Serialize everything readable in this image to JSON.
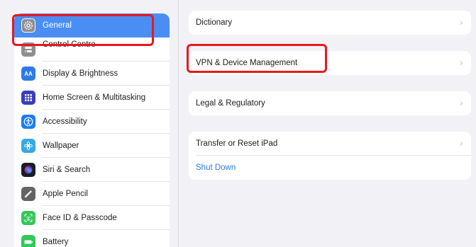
{
  "sidebar": {
    "items": [
      {
        "label": "General",
        "icon": "gear-icon",
        "color": "#8e8e93",
        "selected": true
      },
      {
        "label": "Control Centre",
        "icon": "control-centre-icon",
        "color": "#8e8e93"
      },
      {
        "label": "Display & Brightness",
        "icon": "display-brightness-icon",
        "color": "#2f7ae5",
        "glyph": "AA"
      },
      {
        "label": "Home Screen & Multitasking",
        "icon": "home-screen-icon",
        "color": "#3a3fb8"
      },
      {
        "label": "Accessibility",
        "icon": "accessibility-icon",
        "color": "#1a7cf5"
      },
      {
        "label": "Wallpaper",
        "icon": "wallpaper-icon",
        "color": "#35a9e0"
      },
      {
        "label": "Siri & Search",
        "icon": "siri-icon",
        "color": "#1c1c1e"
      },
      {
        "label": "Apple Pencil",
        "icon": "pencil-icon",
        "color": "#636366"
      },
      {
        "label": "Face ID & Passcode",
        "icon": "face-id-icon",
        "color": "#34c759"
      },
      {
        "label": "Battery",
        "icon": "battery-icon",
        "color": "#34c759"
      }
    ]
  },
  "main": {
    "dictionary_label": "Dictionary",
    "vpn_label": "VPN & Device Management",
    "legal_label": "Legal & Regulatory",
    "transfer_label": "Transfer or Reset iPad",
    "shutdown_label": "Shut Down",
    "chevron": "›"
  },
  "colors": {
    "accent": "#4a8ef4",
    "link": "#2f7ae5",
    "highlight": "#e8181e"
  }
}
